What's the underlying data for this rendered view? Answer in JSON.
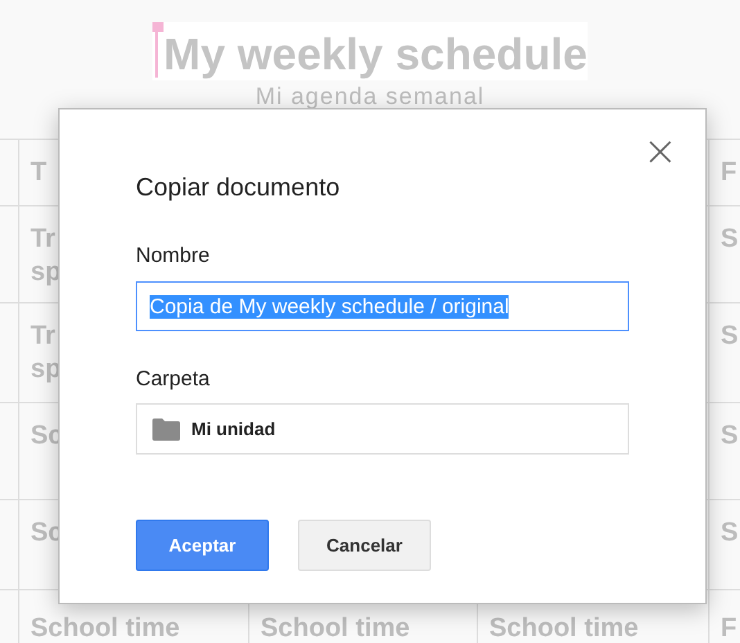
{
  "document": {
    "title": "My weekly schedule",
    "subtitle": "Mi agenda semanal",
    "rows": [
      {
        "column_1": [
          "T"
        ],
        "column_4": [
          "F"
        ]
      },
      {
        "column_1": [
          "Tr",
          "sp"
        ],
        "column_4": [
          "S"
        ]
      },
      {
        "column_1": [
          "Tr",
          "sp"
        ],
        "column_4": [
          "S"
        ]
      },
      {
        "column_1": [
          "Sc"
        ],
        "column_4": [
          "S"
        ]
      },
      {
        "column_1": [
          "Sc"
        ],
        "column_4": [
          "S"
        ]
      },
      {
        "column_1": [
          "School time"
        ],
        "column_2": [
          "School time"
        ],
        "column_3": [
          "School time"
        ],
        "column_4": [
          "F"
        ]
      }
    ]
  },
  "dialog": {
    "title": "Copiar documento",
    "close": "×",
    "name_field": {
      "label": "Nombre",
      "value": "Copia de My weekly schedule / original",
      "value_selected": true
    },
    "folder_field": {
      "label": "Carpeta",
      "value": "Mi unidad"
    },
    "buttons": [
      {
        "label": "Aceptar",
        "kind": "primary"
      },
      {
        "label": "Cancelar",
        "kind": "secondary"
      }
    ]
  }
}
